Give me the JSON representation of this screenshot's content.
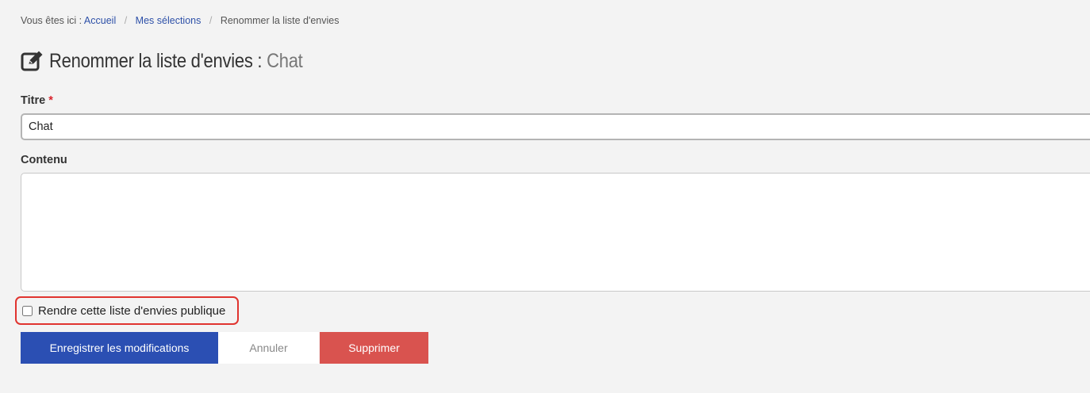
{
  "breadcrumb": {
    "prefix": "Vous êtes ici :",
    "items": [
      {
        "label": "Accueil"
      },
      {
        "label": "Mes sélections"
      },
      {
        "label": "Renommer la liste d'envies"
      }
    ],
    "separator": "/"
  },
  "header": {
    "icon": "edit-icon",
    "title_prefix": "Renommer la liste d'envies :",
    "title_name": "Chat"
  },
  "form": {
    "title_label": "Titre",
    "required_mark": "*",
    "title_value": "Chat",
    "content_label": "Contenu",
    "content_value": "",
    "public_checkbox_label": "Rendre cette liste d'envies publique",
    "public_checked": false
  },
  "actions": {
    "save_label": "Enregistrer les modifications",
    "cancel_label": "Annuler",
    "delete_label": "Supprimer"
  },
  "colors": {
    "primary": "#2b4fb3",
    "danger": "#d9534f",
    "highlight": "#e0342f",
    "link": "#2d50a8"
  }
}
